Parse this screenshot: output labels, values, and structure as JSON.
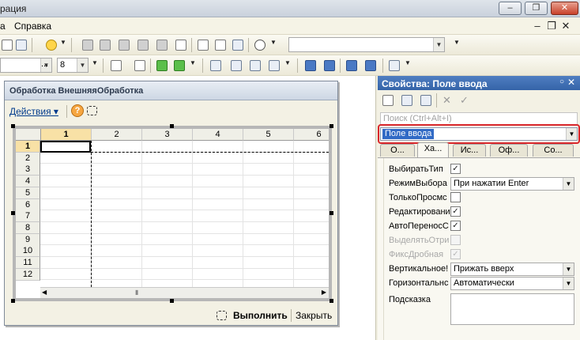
{
  "window": {
    "title": "рация"
  },
  "menu": {
    "items": [
      "а",
      "Справка"
    ]
  },
  "toolbar2": {
    "font_name": "",
    "font_more": "...",
    "font_size": "8",
    "search_combo": ""
  },
  "form": {
    "title": "Обработка  ВнешняяОбработка",
    "actions_label": "Действия",
    "help_glyph": "?",
    "run_label": "Выполнить",
    "close_label": "Закрыть"
  },
  "sheet": {
    "columns": [
      "1",
      "2",
      "3",
      "4",
      "5",
      "6"
    ],
    "rows": [
      "1",
      "2",
      "3",
      "4",
      "5",
      "6",
      "7",
      "8",
      "9",
      "10",
      "11",
      "12"
    ]
  },
  "props": {
    "title": "Свойства: Поле ввода",
    "search_placeholder": "Поиск (Ctrl+Alt+I)",
    "element_type": "Поле ввода",
    "tabs": [
      "О...",
      "Ха...",
      "Ис...",
      "Оф...",
      "Со..."
    ],
    "rows": [
      {
        "label": "ВыбиратьТип",
        "kind": "check",
        "checked": true,
        "disabled": false
      },
      {
        "label": "РежимВыбора",
        "kind": "combo",
        "value": "При нажатии Enter"
      },
      {
        "label": "ТолькоПросмс",
        "kind": "check",
        "checked": false,
        "disabled": false
      },
      {
        "label": "Редактировани",
        "kind": "check",
        "checked": true,
        "disabled": false
      },
      {
        "label": "АвтоПереносС",
        "kind": "check",
        "checked": true,
        "disabled": false
      },
      {
        "label": "ВыделятьОтри",
        "kind": "check",
        "checked": false,
        "disabled": true
      },
      {
        "label": "ФиксДробная",
        "kind": "check",
        "checked": true,
        "disabled": true
      },
      {
        "label": "Вертикальное!",
        "kind": "combo",
        "value": "Прижать вверх"
      },
      {
        "label": "Горизонтальнс",
        "kind": "combo",
        "value": "Автоматически"
      },
      {
        "label": "Подсказка",
        "kind": "text",
        "value": ""
      }
    ]
  },
  "colors": {
    "accent": "#316ac5",
    "highlight_frame": "#d9272b",
    "title_blue": "#3564a8"
  }
}
